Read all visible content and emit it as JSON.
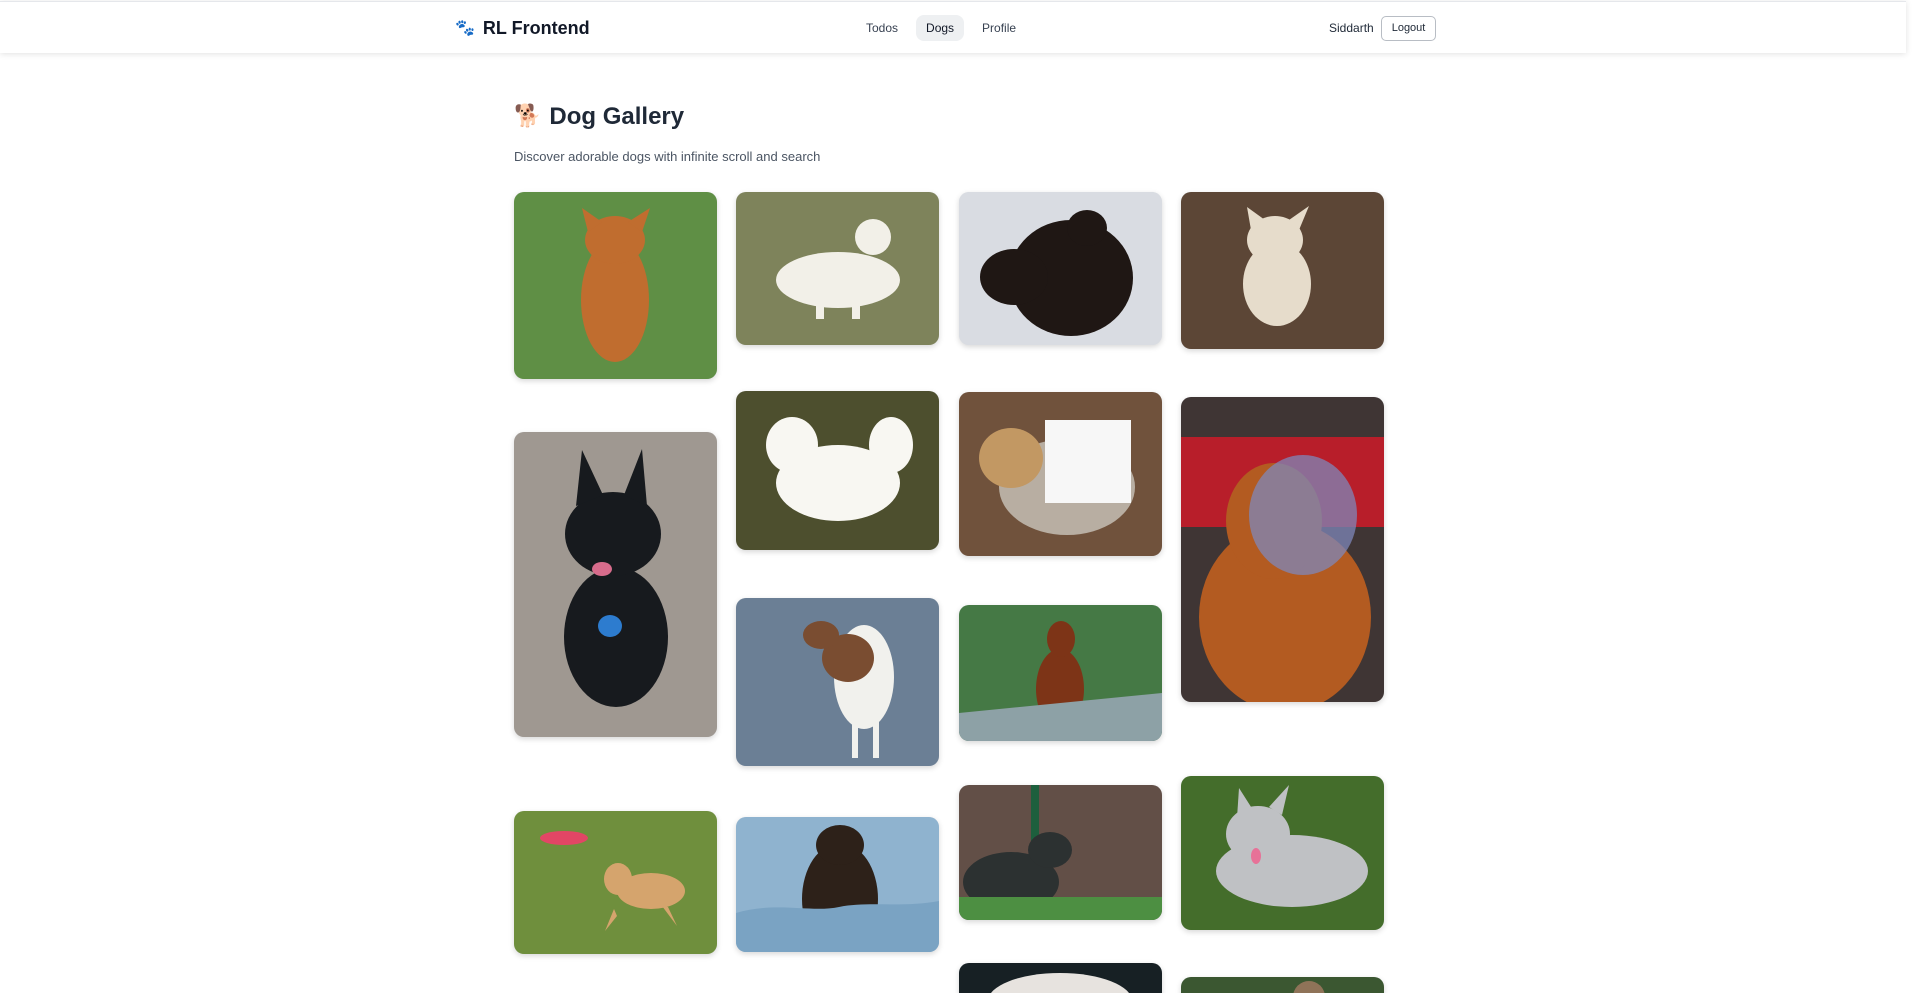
{
  "brand": {
    "icon": "🐾",
    "title": "RL Frontend"
  },
  "nav": {
    "items": [
      {
        "label": "Todos",
        "active": false
      },
      {
        "label": "Dogs",
        "active": true
      },
      {
        "label": "Profile",
        "active": false
      }
    ]
  },
  "user": {
    "name": "Siddarth",
    "logout_label": "Logout"
  },
  "page": {
    "emoji": "🐕",
    "title": "Dog Gallery",
    "subtitle": "Discover adorable dogs with infinite scroll and search"
  },
  "gallery": {
    "items": [
      {
        "alt": "Dog photo 1",
        "colors": [
          "#5f8f45",
          "#c06d2f"
        ]
      },
      {
        "alt": "Dog photo 2",
        "colors": [
          "#7e835b",
          "#f2f0e8"
        ]
      },
      {
        "alt": "Dog photo 3",
        "colors": [
          "#d9dce2",
          "#1f1714"
        ]
      },
      {
        "alt": "Dog photo 4",
        "colors": [
          "#5c4636",
          "#e6dccb"
        ]
      },
      {
        "alt": "Dog photo 5",
        "colors": [
          "#9f9891",
          "#171a1e"
        ]
      },
      {
        "alt": "Dog photo 6",
        "colors": [
          "#4d4f2e",
          "#f8f7f2"
        ]
      },
      {
        "alt": "Dog photo 7",
        "colors": [
          "#70523c",
          "#b8aea2"
        ]
      },
      {
        "alt": "Dog photo 8",
        "colors": [
          "#3f3534",
          "#b35b21"
        ]
      },
      {
        "alt": "Dog photo 9",
        "colors": [
          "#6b7f95",
          "#7a4d31"
        ]
      },
      {
        "alt": "Dog photo 10",
        "colors": [
          "#457945",
          "#7d3417"
        ]
      },
      {
        "alt": "Dog photo 11",
        "colors": [
          "#6f8f3d",
          "#d5a46d"
        ]
      },
      {
        "alt": "Dog photo 12",
        "colors": [
          "#8fb3cf",
          "#2d2119"
        ]
      },
      {
        "alt": "Dog photo 13",
        "colors": [
          "#624f47",
          "#2c3131"
        ]
      },
      {
        "alt": "Dog photo 14",
        "colors": [
          "#446d2b",
          "#bfc1c4"
        ]
      },
      {
        "alt": "Dog photo 15",
        "colors": [
          "#172024",
          "#e7e3df"
        ]
      },
      {
        "alt": "Dog photo 16",
        "colors": [
          "#3b5731",
          "#8f7358"
        ]
      }
    ]
  }
}
